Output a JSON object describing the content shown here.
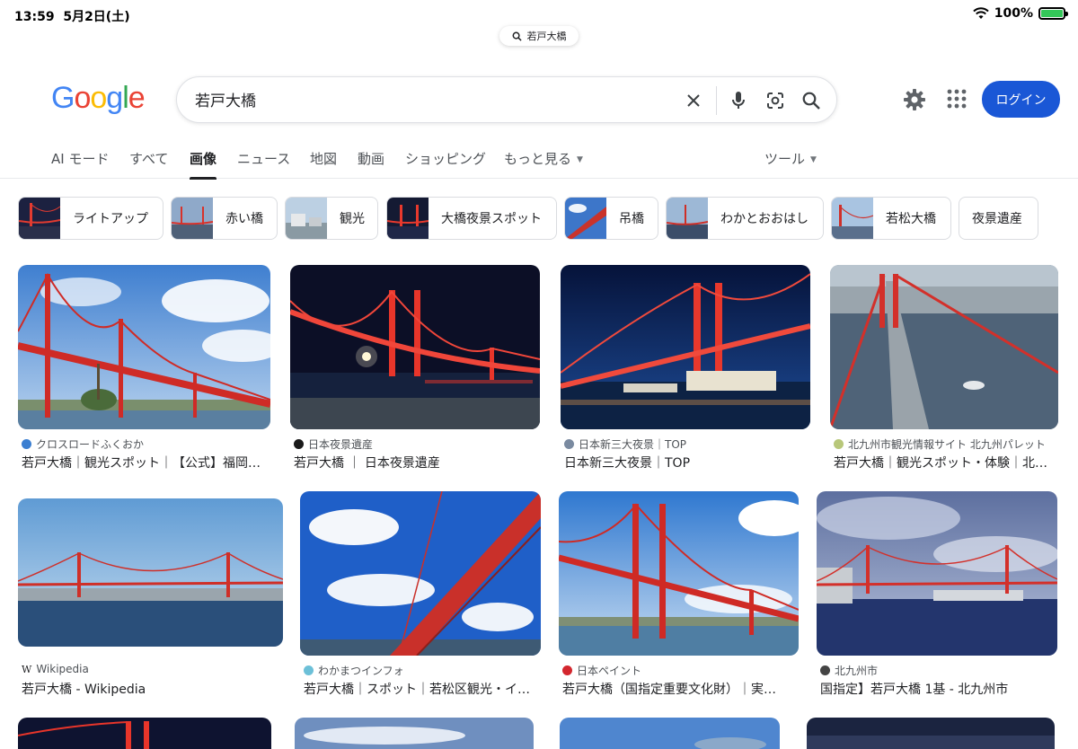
{
  "status": {
    "time": "13:59",
    "date": "5月2日(土)",
    "battery": "100%",
    "battery_level": 1.0
  },
  "url_bar": {
    "text": "若戸大橋"
  },
  "logo": {
    "text": "Google",
    "colors": [
      "#4285F4",
      "#EA4335",
      "#FBBC05",
      "#4285F4",
      "#34A853",
      "#EA4335"
    ]
  },
  "search": {
    "query": "若戸大橋"
  },
  "header": {
    "login_label": "ログイン"
  },
  "tabs": [
    {
      "label": "AI モード"
    },
    {
      "label": "すべて"
    },
    {
      "label": "画像",
      "active": true
    },
    {
      "label": "ニュース"
    },
    {
      "label": "地図"
    },
    {
      "label": "動画"
    },
    {
      "label": "ショッピング"
    },
    {
      "label": "もっと見る"
    }
  ],
  "tools_label": "ツール",
  "chips": [
    {
      "label": "ライトアップ"
    },
    {
      "label": "赤い橋"
    },
    {
      "label": "観光"
    },
    {
      "label": "大橋夜景スポット"
    },
    {
      "label": "吊橋"
    },
    {
      "label": "わかとおおはし"
    },
    {
      "label": "若松大橋"
    },
    {
      "label": "夜景遺産"
    }
  ],
  "results": [
    {
      "source": "クロスロードふくおか",
      "title": "若戸大橋｜観光スポット｜【公式】福岡県の観光/旅行情報",
      "favicon_color": "#3b7fd1",
      "scene": "day"
    },
    {
      "source": "日本夜景遺産",
      "title": "若戸大橋 ｜ 日本夜景遺産",
      "favicon_color": "#1a1a1a",
      "scene": "night"
    },
    {
      "source": "日本新三大夜景｜TOP",
      "title": "日本新三大夜景｜TOP",
      "favicon_color": "#7a8aa0",
      "scene": "night2"
    },
    {
      "source": "北九州市観光情報サイト 北九州パレット",
      "title": "若戸大橋｜観光スポット・体験｜北九州市観光情報サイト",
      "favicon_color": "#b8c77a",
      "scene": "aerial"
    },
    {
      "source": "Wikipedia",
      "title": "若戸大橋 - Wikipedia",
      "favicon_color": "#555555",
      "scene": "wide"
    },
    {
      "source": "わかまつインフォ",
      "title": "若戸大橋｜スポット｜若松区観光・イベント情報",
      "favicon_color": "#6cc0d8",
      "scene": "low"
    },
    {
      "source": "日本ペイント",
      "title": "若戸大橋（国指定重要文化財）｜実績紹介",
      "favicon_color": "#d3272e",
      "scene": "day2"
    },
    {
      "source": "北九州市",
      "title": "国指定】若戸大橋 1基 - 北九州市",
      "favicon_color": "#444444",
      "scene": "cloudy"
    }
  ]
}
